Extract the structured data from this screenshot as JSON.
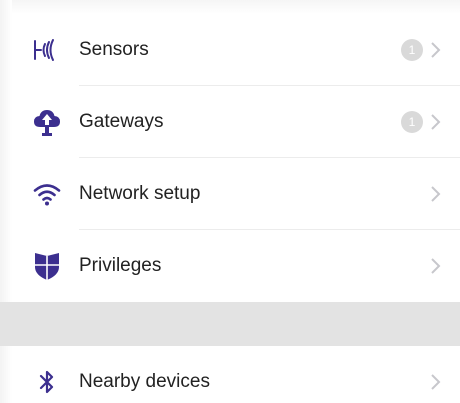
{
  "menu": {
    "items": [
      {
        "label": "Sensors",
        "icon": "sensor-signal-icon",
        "badge": "1"
      },
      {
        "label": "Gateways",
        "icon": "cloud-upload-icon",
        "badge": "1"
      },
      {
        "label": "Network setup",
        "icon": "wifi-icon"
      },
      {
        "label": "Privileges",
        "icon": "shield-icon"
      }
    ]
  },
  "nearby": {
    "label": "Nearby devices",
    "icon": "bluetooth-icon"
  },
  "colors": {
    "accent": "#3c2f8f",
    "badge": "#d9d9d9",
    "chevron": "#c7c7cc",
    "separator": "#e3e3e3"
  }
}
